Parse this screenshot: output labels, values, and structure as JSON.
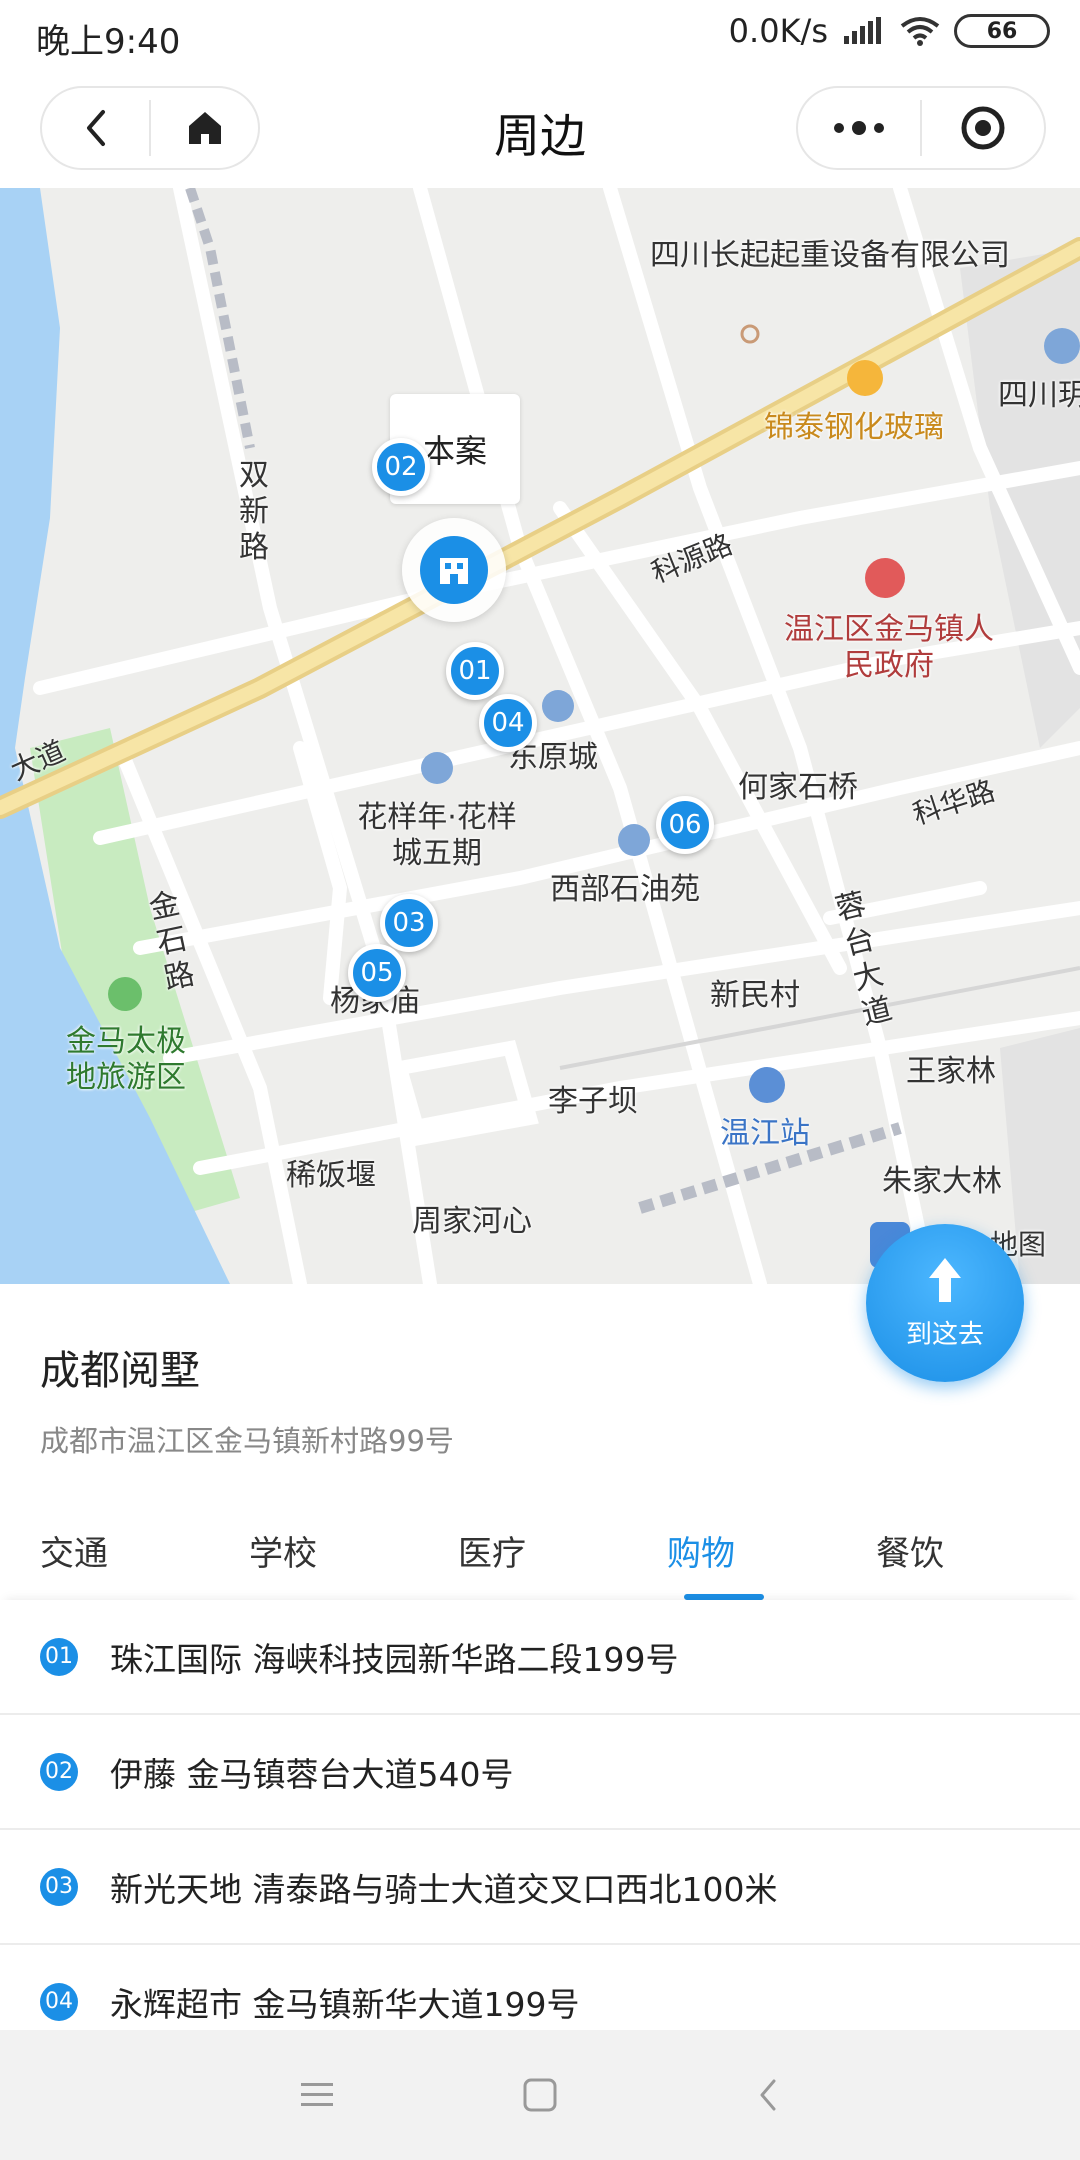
{
  "status_bar": {
    "time": "晚上9:40",
    "network_speed": "0.0K/s",
    "battery": "66"
  },
  "nav_bar": {
    "title": "周边",
    "icons": [
      "back-icon",
      "home-icon",
      "more-icon",
      "close-target-icon"
    ]
  },
  "map": {
    "road_labels": [
      "双新路",
      "科源路",
      "科华路",
      "金石路",
      "蓉台大道",
      "大道"
    ],
    "place_labels": [
      "四川长起起重设备有限公司",
      "锦泰钢化玻璃",
      "温江区金马镇人民政府",
      "何家石桥",
      "东原城",
      "花样年·花样城五期",
      "西部石油苑",
      "新民村",
      "杨家庙",
      "金马太极地旅游区",
      "王家林",
      "李子坝",
      "温江站",
      "稀饭堰",
      "周家河心",
      "朱家大林",
      "四川玥",
      "地图"
    ],
    "callout_text": "本案",
    "poi_markers": [
      "01",
      "02",
      "03",
      "04",
      "05",
      "06"
    ],
    "colors": {
      "marker": "#1b8fe6",
      "river": "#a8d2f5",
      "park": "#c8ebc0",
      "arterial": "#f5df9a"
    }
  },
  "go_button": {
    "label": "到这去",
    "icon": "arrow-up-icon"
  },
  "place": {
    "title": "成都阅墅",
    "address": "成都市温江区金马镇新村路99号"
  },
  "tabs": [
    {
      "label": "交通",
      "active": false
    },
    {
      "label": "学校",
      "active": false
    },
    {
      "label": "医疗",
      "active": false
    },
    {
      "label": "购物",
      "active": true
    },
    {
      "label": "餐饮",
      "active": false
    }
  ],
  "results": [
    {
      "num": "01",
      "text": "珠江国际 海峡科技园新华路二段199号"
    },
    {
      "num": "02",
      "text": "伊藤 金马镇蓉台大道540号"
    },
    {
      "num": "03",
      "text": "新光天地 清泰路与骑士大道交叉口西北100米"
    },
    {
      "num": "04",
      "text": "永辉超市 金马镇新华大道199号"
    }
  ],
  "system_nav": [
    "menu-icon",
    "home-square-icon",
    "back-chevron-icon"
  ]
}
